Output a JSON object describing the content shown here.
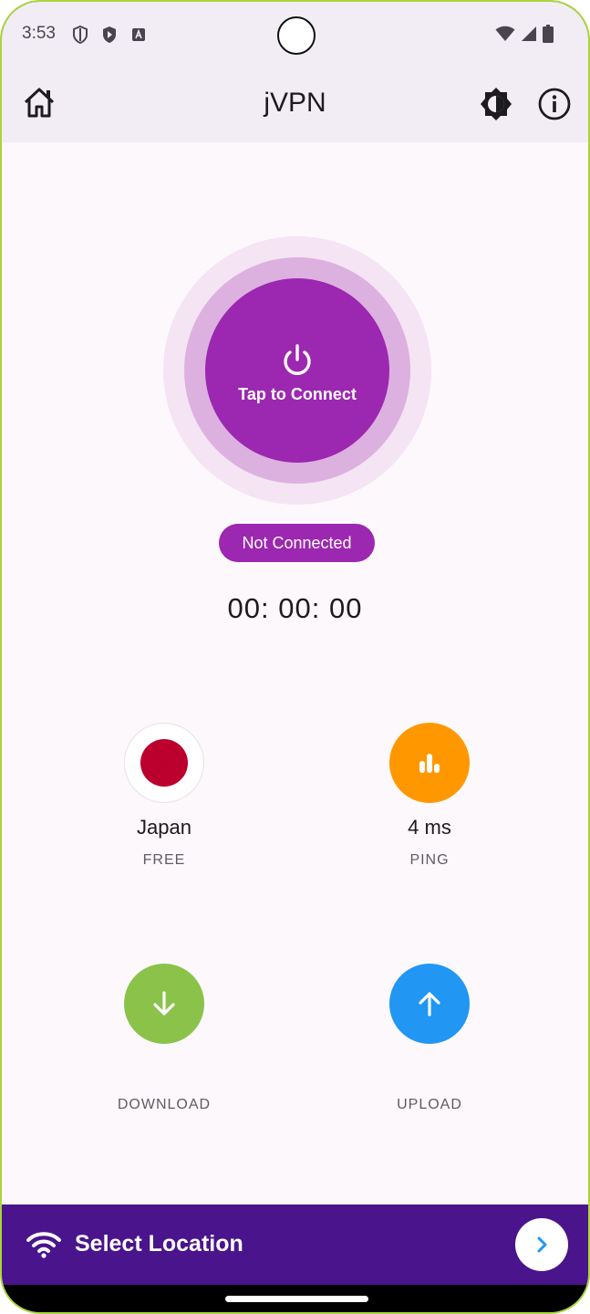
{
  "status_bar": {
    "time": "3:53",
    "left_icons": [
      "shield-icon",
      "play-protect-icon",
      "accessibility-icon"
    ],
    "right_icons": [
      "wifi-signal-icon",
      "cell-signal-icon",
      "battery-icon"
    ]
  },
  "app_bar": {
    "title": "jVPN",
    "left_icon": "home-icon",
    "right_icons": [
      "brightness-icon",
      "info-icon"
    ]
  },
  "connect": {
    "label": "Tap to Connect",
    "icon": "power-icon",
    "status": "Not Connected",
    "timer": "00: 00: 00"
  },
  "stats": {
    "location": {
      "value": "Japan",
      "label": "FREE",
      "icon": "japan-flag-icon"
    },
    "ping": {
      "value": "4 ms",
      "label": "PING",
      "icon": "bar-chart-icon"
    },
    "download": {
      "value": "",
      "label": "DOWNLOAD",
      "icon": "arrow-down-icon"
    },
    "upload": {
      "value": "",
      "label": "UPLOAD",
      "icon": "arrow-up-icon"
    }
  },
  "bottom_bar": {
    "label": "Select Location",
    "left_icon": "wifi-icon",
    "right_icon": "chevron-right-icon"
  },
  "colors": {
    "primary": "#9c27b0",
    "bottom_bar": "#4a148c",
    "ping": "#ff9800",
    "download": "#8bc34a",
    "upload": "#2196f3",
    "flag_red": "#bc002d"
  }
}
